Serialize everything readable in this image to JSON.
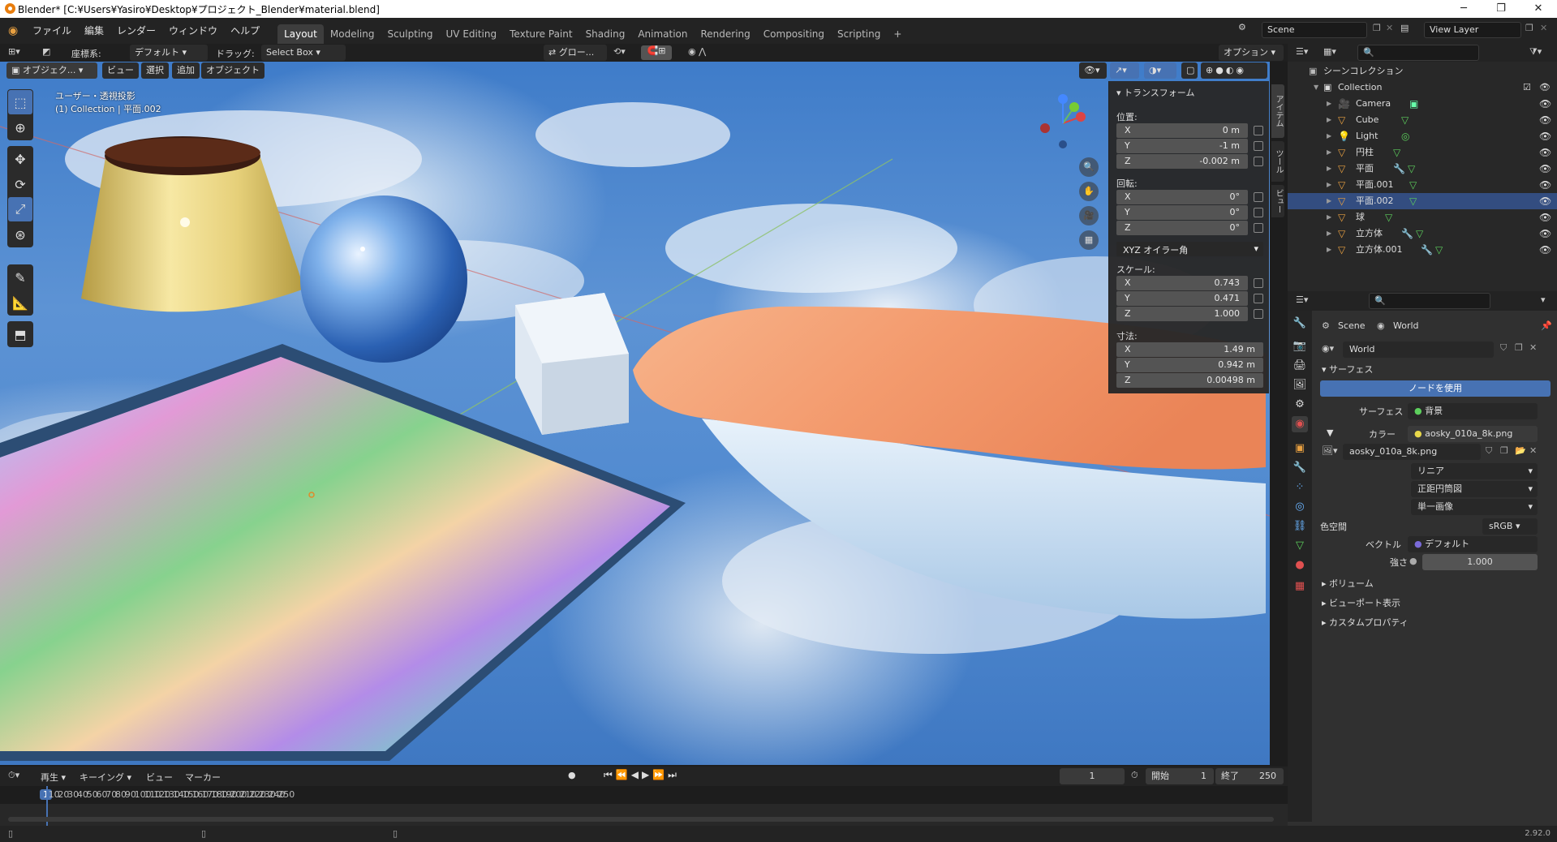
{
  "window": {
    "title": "Blender* [C:¥Users¥Yasiro¥Desktop¥プロジェクト_Blender¥material.blend]"
  },
  "menu": [
    "ファイル",
    "編集",
    "レンダー",
    "ウィンドウ",
    "ヘルプ"
  ],
  "workspaces": [
    "Layout",
    "Modeling",
    "Sculpting",
    "UV Editing",
    "Texture Paint",
    "Shading",
    "Animation",
    "Rendering",
    "Compositing",
    "Scripting"
  ],
  "active_workspace": "Layout",
  "scene": "Scene",
  "view_layer": "View Layer",
  "tool_header": {
    "coord_label": "座標系:",
    "coord_value": "デフォルト",
    "drag_label": "ドラッグ:",
    "drag_value": "Select Box",
    "pivot": "グロー...",
    "options": "オプション"
  },
  "viewport_header": {
    "mode": "オブジェク...",
    "menus": [
      "ビュー",
      "選択",
      "追加",
      "オブジェクト"
    ]
  },
  "viewport_overlay": {
    "view_name": "ユーザー・透視投影",
    "collection_info": "(1) Collection | 平面.002"
  },
  "n_panel": {
    "title": "トランスフォーム",
    "location_label": "位置:",
    "location": [
      {
        "axis": "X",
        "value": "0 m"
      },
      {
        "axis": "Y",
        "value": "-1 m"
      },
      {
        "axis": "Z",
        "value": "-0.002 m"
      }
    ],
    "rotation_label": "回転:",
    "rotation": [
      {
        "axis": "X",
        "value": "0°"
      },
      {
        "axis": "Y",
        "value": "0°"
      },
      {
        "axis": "Z",
        "value": "0°"
      }
    ],
    "rotation_mode": "XYZ オイラー角",
    "scale_label": "スケール:",
    "scale": [
      {
        "axis": "X",
        "value": "0.743"
      },
      {
        "axis": "Y",
        "value": "0.471"
      },
      {
        "axis": "Z",
        "value": "1.000"
      }
    ],
    "dimensions_label": "寸法:",
    "dimensions": [
      {
        "axis": "X",
        "value": "1.49 m"
      },
      {
        "axis": "Y",
        "value": "0.942 m"
      },
      {
        "axis": "Z",
        "value": "0.00498 m"
      }
    ],
    "tabs": [
      "アイテム",
      "ツール",
      "ビュー"
    ]
  },
  "outliner": {
    "root": "シーンコレクション",
    "collection": "Collection",
    "items": [
      "Camera",
      "Cube",
      "Light",
      "円柱",
      "平面",
      "平面.001",
      "平面.002",
      "球",
      "立方体",
      "立方体.001"
    ]
  },
  "properties": {
    "breadcrumb_scene": "Scene",
    "breadcrumb_world": "World",
    "world_name": "World",
    "surface_panel": "サーフェス",
    "use_nodes": "ノードを使用",
    "surface_label": "サーフェス",
    "surface_value": "背景",
    "color_label": "カラー",
    "color_value": "aosky_010a_8k.png",
    "image_name": "aosky_010a_8k.png",
    "interpolation": "リニア",
    "projection": "正距円筒図",
    "source": "単一画像",
    "colorspace_label": "色空間",
    "colorspace_value": "sRGB",
    "vector_label": "ベクトル",
    "vector_value": "デフォルト",
    "strength_label": "強さ",
    "strength_value": "1.000",
    "panels": [
      "ボリューム",
      "ビューポート表示",
      "カスタムプロパティ"
    ]
  },
  "timeline": {
    "menus": [
      "再生",
      "キーイング",
      "ビュー",
      "マーカー"
    ],
    "current_frame": "1",
    "start_label": "開始",
    "start": "1",
    "end_label": "終了",
    "end": "250",
    "ruler": [
      "1",
      "10",
      "20",
      "30",
      "40",
      "50",
      "60",
      "70",
      "80",
      "90",
      "100",
      "110",
      "120",
      "130",
      "140",
      "150",
      "160",
      "170",
      "180",
      "190",
      "200",
      "210",
      "220",
      "230",
      "240",
      "250"
    ]
  },
  "status": {
    "version": "2.92.0"
  },
  "colors": {
    "accent": "#4772b3",
    "header": "#232323",
    "panel": "#303030",
    "object_orange": "#e8a041",
    "mesh_green": "#5dcf5d"
  }
}
